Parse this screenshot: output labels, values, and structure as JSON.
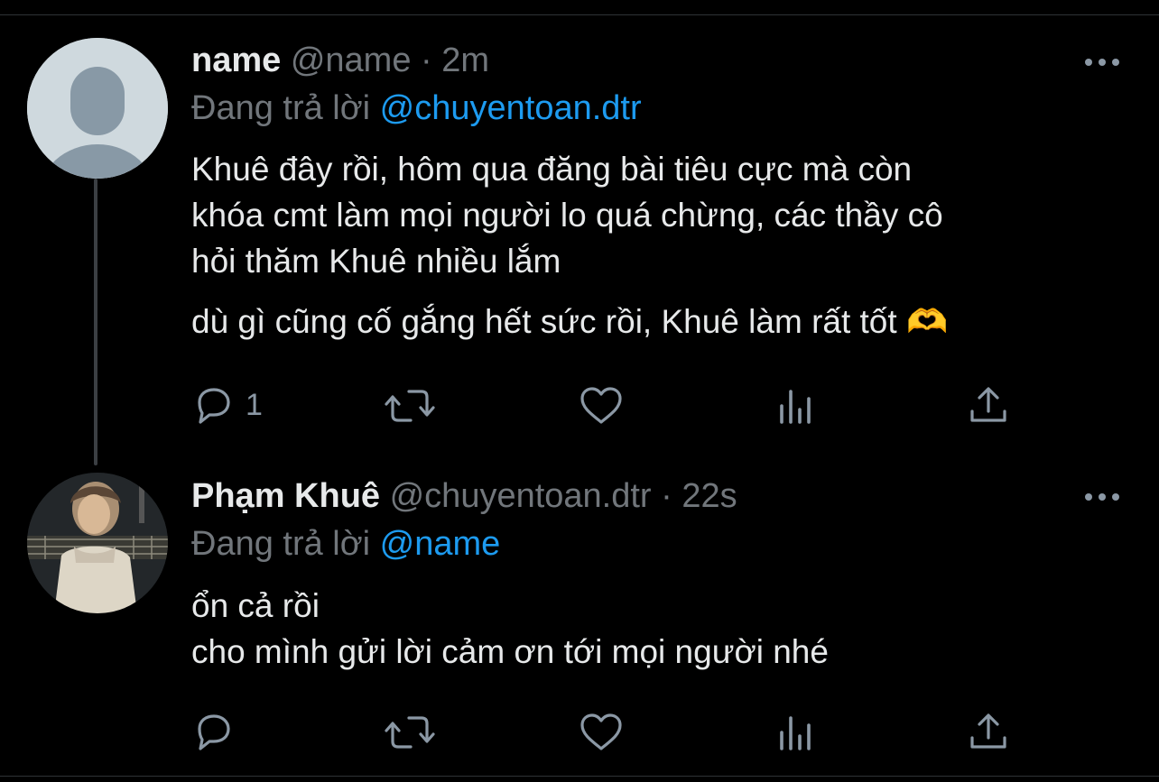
{
  "tweets": [
    {
      "display_name": "name",
      "handle": "@name",
      "separator": "·",
      "time": "2m",
      "replying_label": "Đang trả lời",
      "replying_to": "@chuyentoan.dtr",
      "text_lines": [
        "Khuê đây rồi, hôm qua đăng bài tiêu cực mà còn",
        "khóa cmt làm mọi người lo quá chừng, các thầy cô",
        "hỏi thăm Khuê nhiều lắm",
        "dù gì cũng cố gắng hết sức rồi, Khuê làm rất tốt 🫶"
      ],
      "reply_count": "1"
    },
    {
      "display_name": "Phạm Khuê",
      "handle": "@chuyentoan.dtr",
      "separator": "·",
      "time": "22s",
      "replying_label": "Đang trả lời",
      "replying_to": "@name",
      "text_lines": [
        "ổn cả rồi",
        "cho mình gửi lời cảm ơn tới mọi người nhé"
      ],
      "reply_count": ""
    }
  ],
  "icons": {
    "reply": "reply-icon",
    "retweet": "retweet-icon",
    "like": "like-icon",
    "views": "views-icon",
    "share": "share-icon",
    "more": "more-icon"
  },
  "colors": {
    "background": "#000000",
    "text": "#e7e9ea",
    "muted": "#71767b",
    "link": "#1d9bf0",
    "icon": "#8b98a5"
  }
}
